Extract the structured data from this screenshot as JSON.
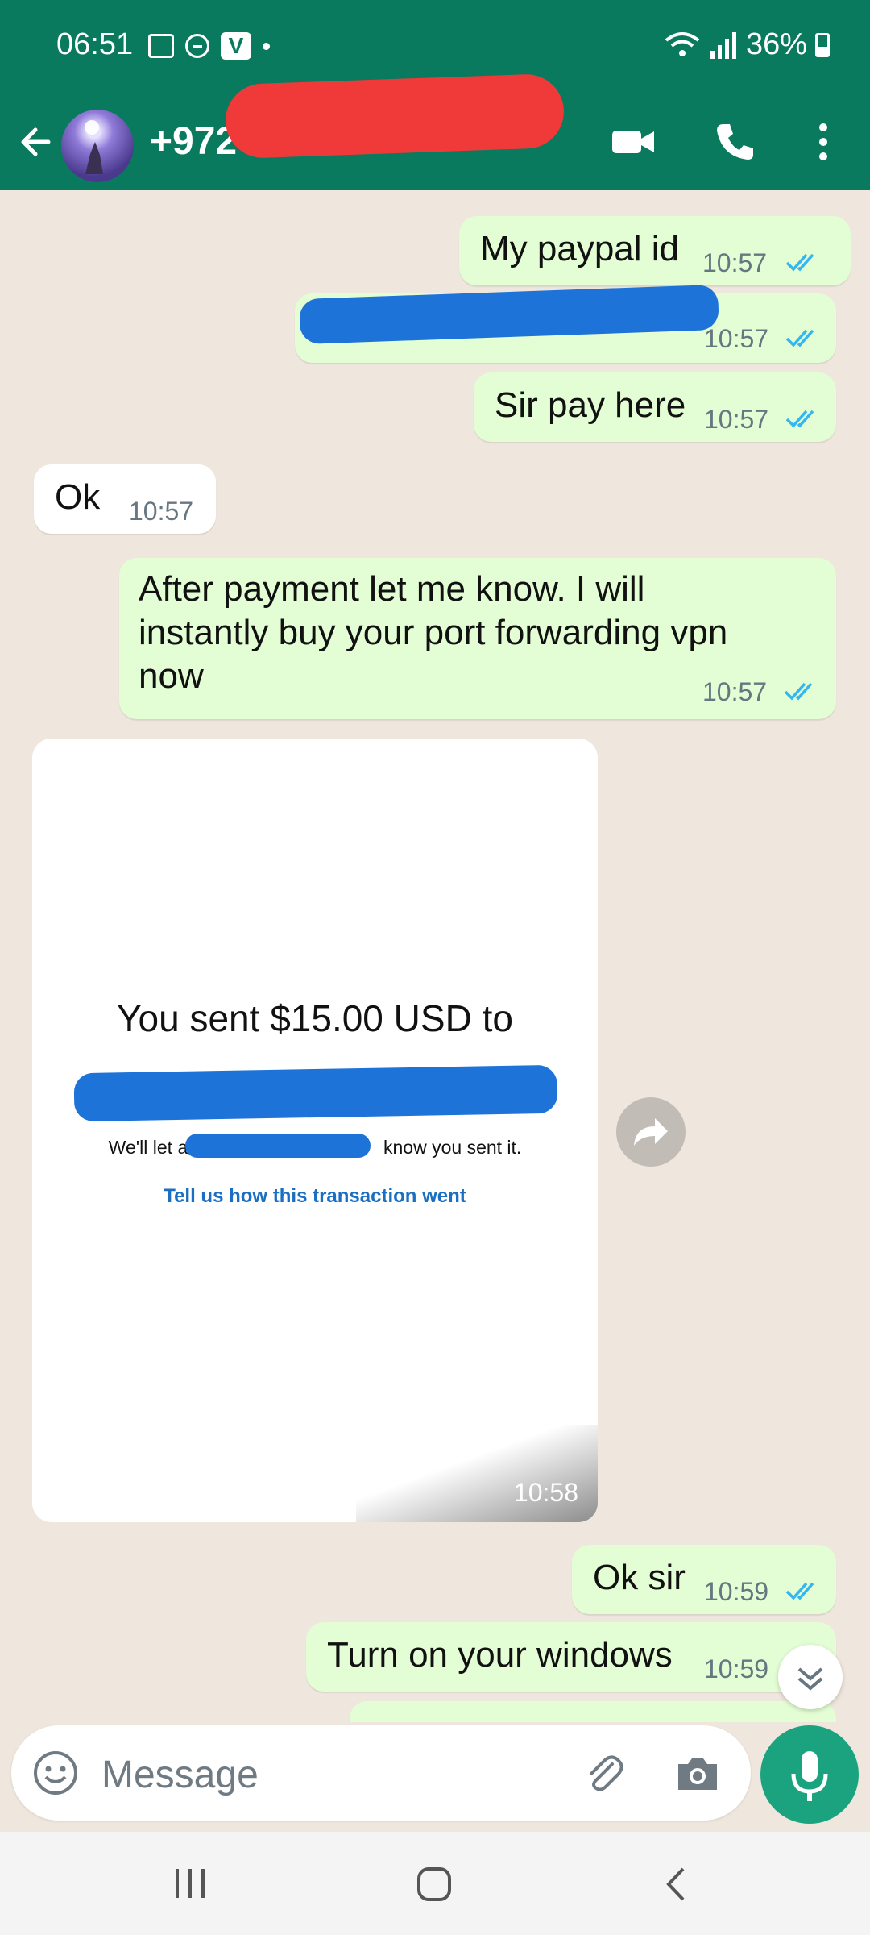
{
  "status": {
    "time": "06:51",
    "battery": "36%"
  },
  "header": {
    "contact": "+972"
  },
  "messages": [
    {
      "text": "My paypal id",
      "time": "10:57"
    },
    {
      "text": "",
      "time": "10:57"
    },
    {
      "text": "Sir pay here",
      "time": "10:57"
    },
    {
      "text": "Ok",
      "time": "10:57"
    },
    {
      "text": "After payment let me know. I will instantly buy your port forwarding vpn now",
      "time": "10:57"
    },
    {
      "text": "Ok sir",
      "time": "10:59"
    },
    {
      "text": "Turn on your windows",
      "time": "10:59"
    }
  ],
  "image_message": {
    "title": "You sent $15.00 USD to",
    "subtitle_left": "We'll let a",
    "subtitle_right": "know you sent it.",
    "link": "Tell us how this transaction went",
    "time": "10:58"
  },
  "composer": {
    "placeholder": "Message"
  },
  "icons": [
    "back-arrow-icon",
    "avatar",
    "video-call-icon",
    "phone-icon",
    "more-vert-icon",
    "emoji-icon",
    "attach-icon",
    "camera-icon",
    "mic-icon",
    "forward-icon",
    "double-chevron-down-icon",
    "recent-apps-icon",
    "home-icon",
    "back-icon"
  ],
  "colors": {
    "header": "#0a7a5f",
    "outgoing": "#e3fdd4",
    "incoming": "#ffffff",
    "tick": "#34b7f1",
    "mic": "#1aa37e"
  }
}
